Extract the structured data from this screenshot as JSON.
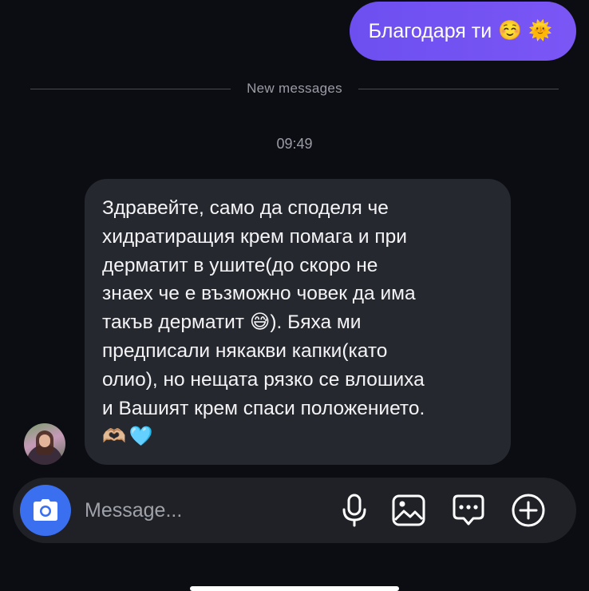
{
  "sent_message": {
    "text": "Благодаря ти",
    "emojis": [
      "☺️",
      "🌞"
    ]
  },
  "divider": {
    "label": "New messages"
  },
  "timestamp": "09:49",
  "received_message": {
    "text": "Здравейте, само да споделя че\nхидратиращия крем помага и при\nдерматит в ушите(до скоро не\nзнаех че е възможно човек да има\nтакъв дерматит 😅).  Бяха ми\nпредписали някакви капки(като\nолио), но нещата рязко се влошиха\nи Вашият крем спаси положението.",
    "emojis": [
      "🫶🏼",
      "🩵"
    ]
  },
  "composer": {
    "placeholder": "Message...",
    "actions": [
      "camera-icon",
      "microphone-icon",
      "gallery-icon",
      "sticker-icon",
      "add-icon"
    ]
  },
  "colors": {
    "background": "#0c0d12",
    "sent_bubble": "#7452f3",
    "received_bubble": "#262830",
    "camera_button": "#3a6ff0"
  }
}
